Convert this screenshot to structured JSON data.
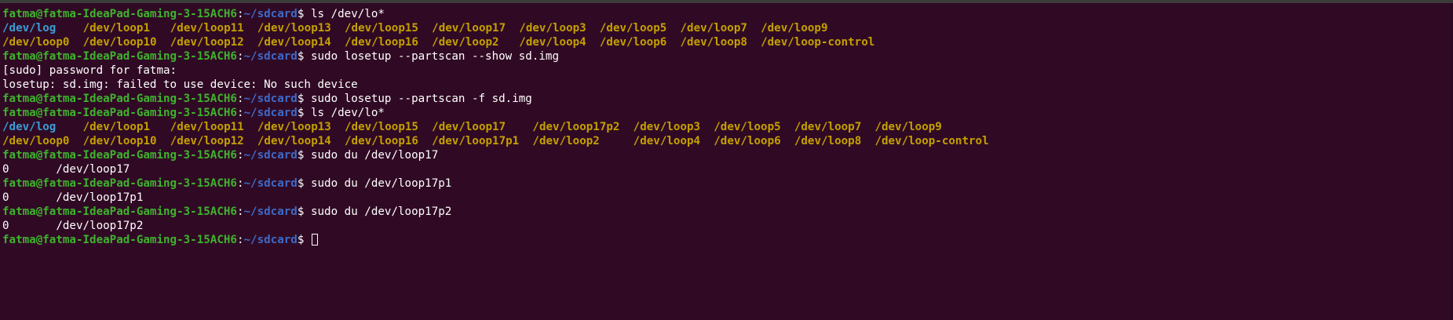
{
  "colors": {
    "background": "#300a24",
    "prompt_user": "#3fb22e",
    "prompt_path": "#3d6ac9",
    "ls_directory": "#3a9dd6",
    "ls_device": "#c4a000",
    "text": "#ffffff"
  },
  "prompt": {
    "user_host": "fatma@fatma-IdeaPad-Gaming-3-15ACH6",
    "colon": ":",
    "path": "~/sdcard",
    "symbol": "$ "
  },
  "blocks": [
    {
      "kind": "cmd",
      "text": "ls /dev/lo*"
    },
    {
      "kind": "ls",
      "rows": [
        [
          "/dev/log",
          "/dev/loop1",
          "/dev/loop11",
          "/dev/loop13",
          "/dev/loop15",
          "/dev/loop17",
          "/dev/loop3",
          "/dev/loop5",
          "/dev/loop7",
          "/dev/loop9"
        ],
        [
          "/dev/loop0",
          "/dev/loop10",
          "/dev/loop12",
          "/dev/loop14",
          "/dev/loop16",
          "/dev/loop2",
          "/dev/loop4",
          "/dev/loop6",
          "/dev/loop8",
          "/dev/loop-control"
        ]
      ]
    },
    {
      "kind": "cmd",
      "text": "sudo losetup --partscan --show sd.img"
    },
    {
      "kind": "out",
      "text": "[sudo] password for fatma:"
    },
    {
      "kind": "out",
      "text": "losetup: sd.img: failed to use device: No such device"
    },
    {
      "kind": "cmd",
      "text": "sudo losetup --partscan -f sd.img"
    },
    {
      "kind": "cmd",
      "text": "ls /dev/lo*"
    },
    {
      "kind": "ls",
      "rows": [
        [
          "/dev/log",
          "/dev/loop1",
          "/dev/loop11",
          "/dev/loop13",
          "/dev/loop15",
          "/dev/loop17",
          "/dev/loop17p2",
          "/dev/loop3",
          "/dev/loop5",
          "/dev/loop7",
          "/dev/loop9"
        ],
        [
          "/dev/loop0",
          "/dev/loop10",
          "/dev/loop12",
          "/dev/loop14",
          "/dev/loop16",
          "/dev/loop17p1",
          "/dev/loop2",
          "/dev/loop4",
          "/dev/loop6",
          "/dev/loop8",
          "/dev/loop-control"
        ]
      ]
    },
    {
      "kind": "cmd",
      "text": "sudo du /dev/loop17"
    },
    {
      "kind": "out",
      "text": "0       /dev/loop17"
    },
    {
      "kind": "cmd",
      "text": "sudo du /dev/loop17p1"
    },
    {
      "kind": "out",
      "text": "0       /dev/loop17p1"
    },
    {
      "kind": "cmd",
      "text": "sudo du /dev/loop17p2"
    },
    {
      "kind": "out",
      "text": "0       /dev/loop17p2"
    },
    {
      "kind": "cmd",
      "text": "",
      "cursor": true
    }
  ]
}
